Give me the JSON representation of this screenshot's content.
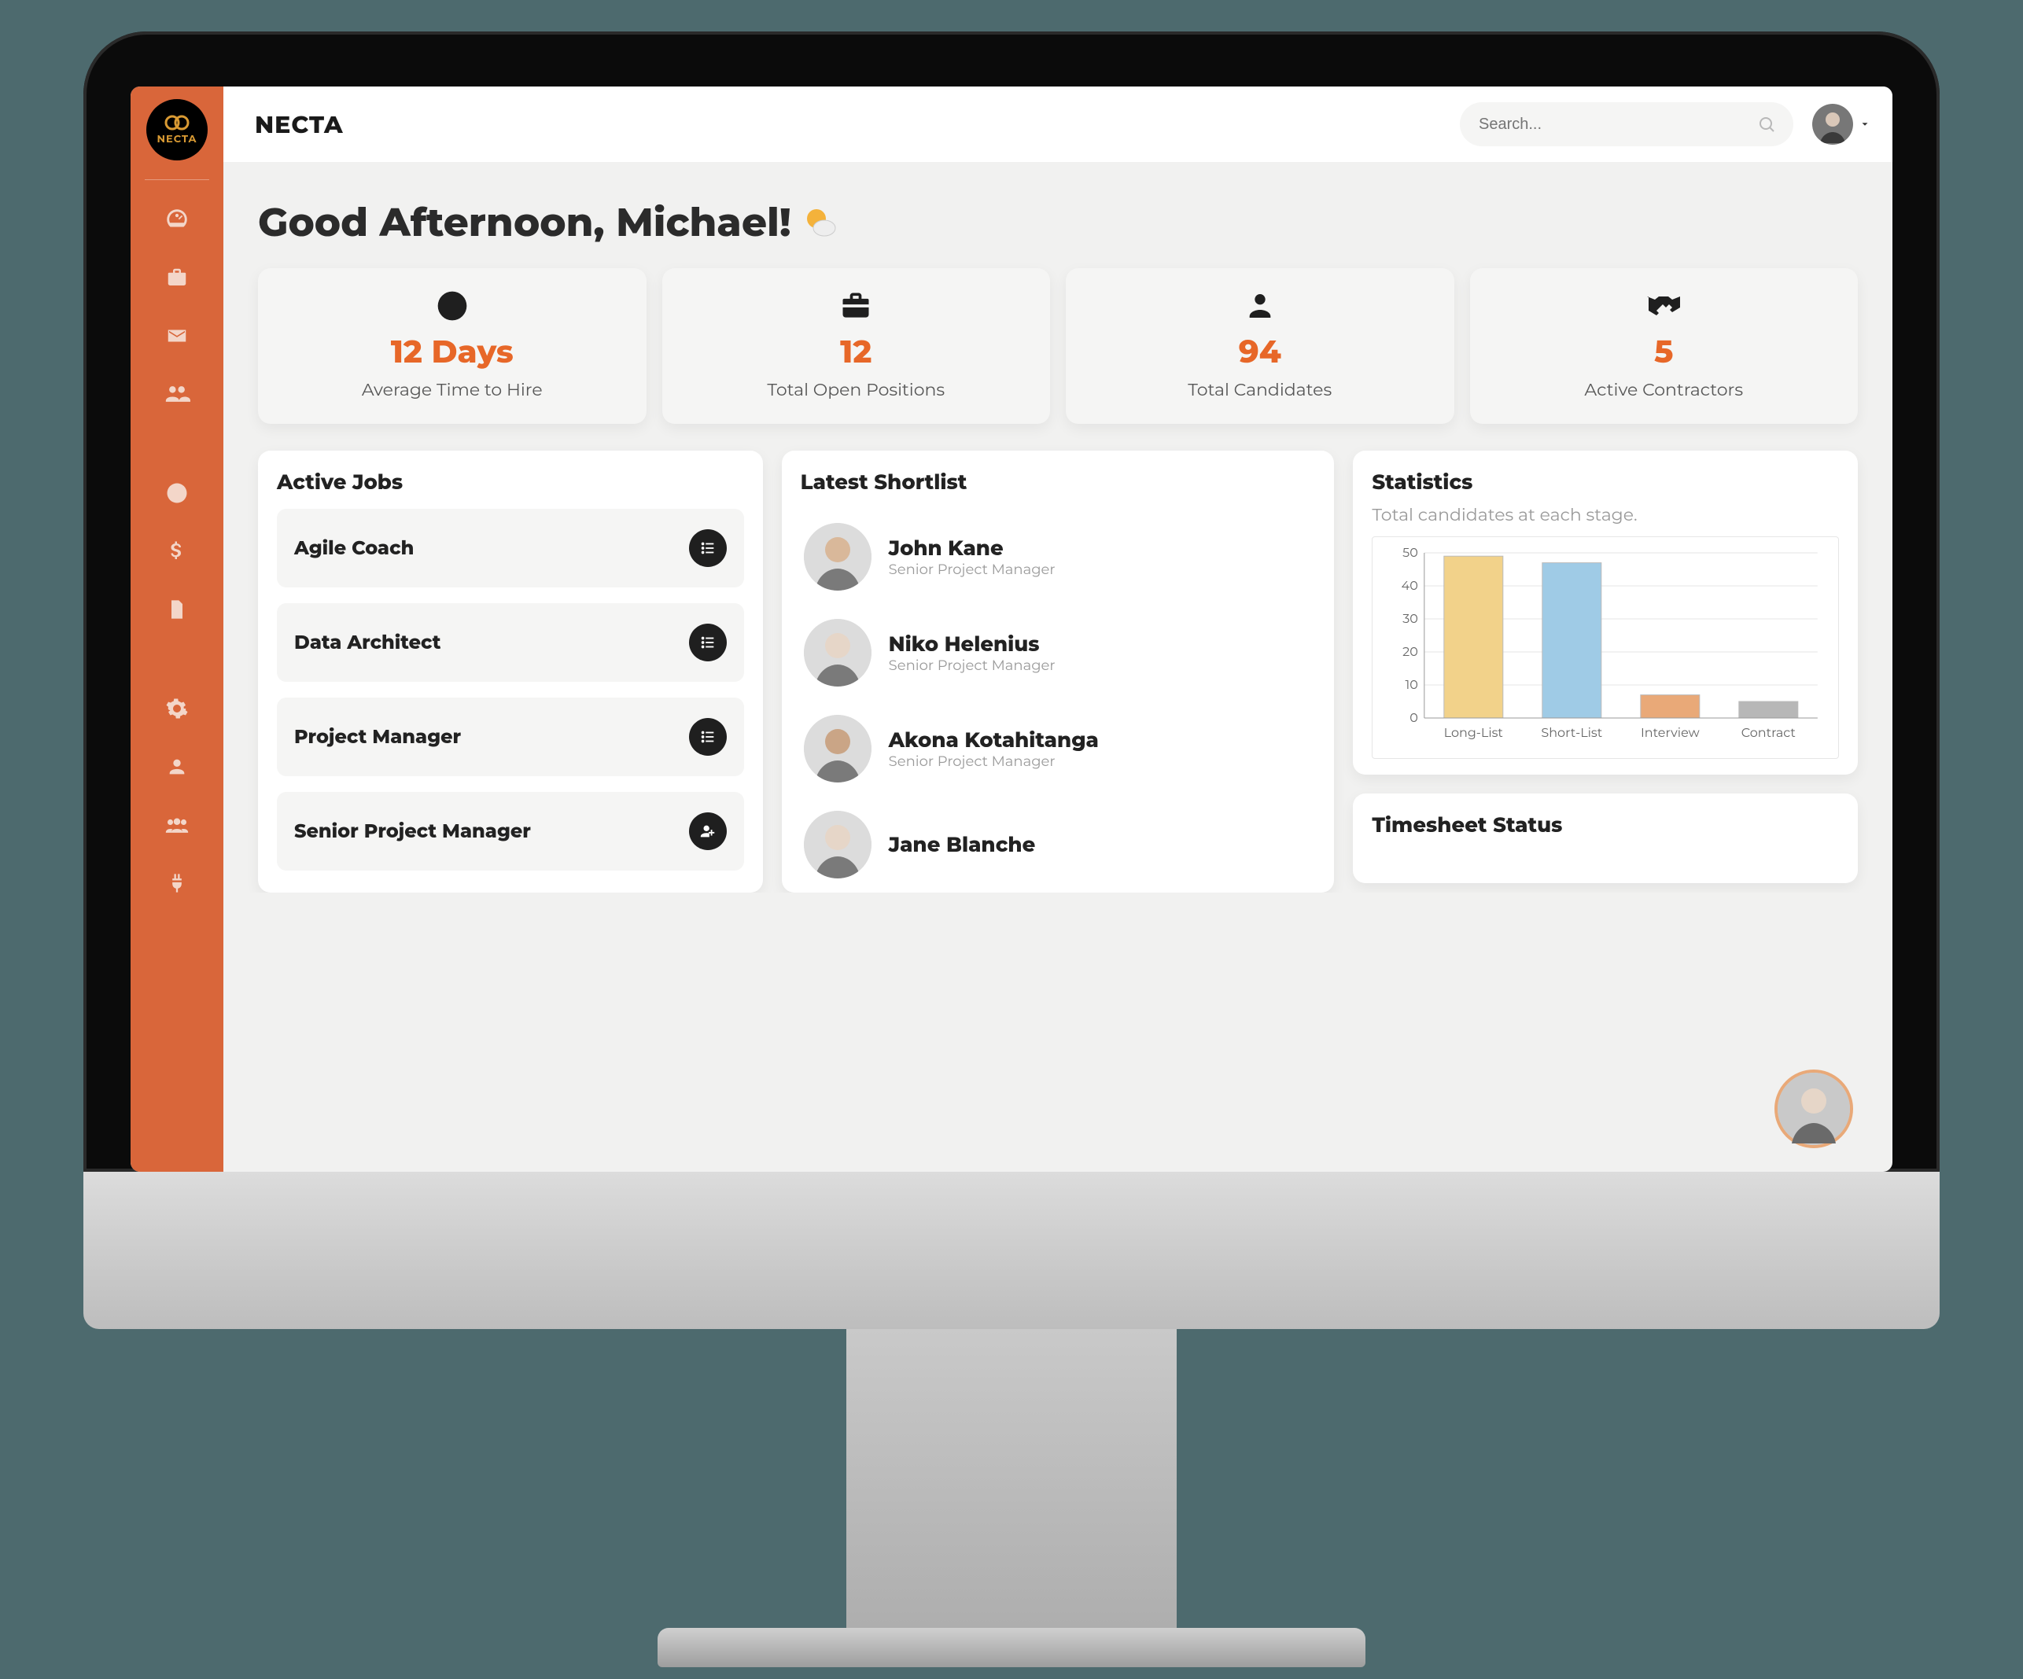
{
  "brand": {
    "word": "NECTA",
    "chip_text": "NECTA"
  },
  "search": {
    "placeholder": "Search..."
  },
  "sidebar": {
    "items": [
      {
        "name": "dashboard-icon"
      },
      {
        "name": "briefcase-icon"
      },
      {
        "name": "envelope-icon"
      },
      {
        "name": "users-icon"
      },
      {
        "name": "clock-icon"
      },
      {
        "name": "dollar-icon"
      },
      {
        "name": "file-icon"
      },
      {
        "name": "gear-icon"
      },
      {
        "name": "user-icon"
      },
      {
        "name": "group-icon"
      },
      {
        "name": "plug-icon"
      }
    ]
  },
  "greeting": "Good Afternoon, Michael!",
  "kpis": [
    {
      "icon": "clock-icon",
      "value": "12 Days",
      "label": "Average Time to Hire"
    },
    {
      "icon": "briefcase-icon",
      "value": "12",
      "label": "Total Open Positions"
    },
    {
      "icon": "person-icon",
      "value": "94",
      "label": "Total Candidates"
    },
    {
      "icon": "handshake-icon",
      "value": "5",
      "label": "Active Contractors"
    }
  ],
  "active_jobs": {
    "heading": "Active Jobs",
    "items": [
      {
        "title": "Agile Coach",
        "action": "list-icon"
      },
      {
        "title": "Data Architect",
        "action": "list-icon"
      },
      {
        "title": "Project Manager",
        "action": "list-icon"
      },
      {
        "title": "Senior Project Manager",
        "action": "user-add-icon"
      }
    ]
  },
  "shortlist": {
    "heading": "Latest Shortlist",
    "items": [
      {
        "name": "John Kane",
        "role": "Senior Project Manager"
      },
      {
        "name": "Niko Helenius",
        "role": "Senior Project Manager"
      },
      {
        "name": "Akona Kotahitanga",
        "role": "Senior Project Manager"
      },
      {
        "name": "Jane Blanche",
        "role": ""
      }
    ]
  },
  "statistics": {
    "heading": "Statistics",
    "sub": "Total candidates at each stage."
  },
  "timesheet": {
    "heading": "Timesheet Status"
  },
  "chart_data": {
    "type": "bar",
    "title": "",
    "xlabel": "",
    "ylabel": "",
    "ylim": [
      0,
      50
    ],
    "yticks": [
      0,
      10,
      20,
      30,
      40,
      50
    ],
    "categories": [
      "Long-List",
      "Short-List",
      "Interview",
      "Contract"
    ],
    "values": [
      49,
      47,
      7,
      5
    ],
    "colors": [
      "#f2d28a",
      "#9fcbe6",
      "#e9a978",
      "#b7b7b7"
    ]
  }
}
